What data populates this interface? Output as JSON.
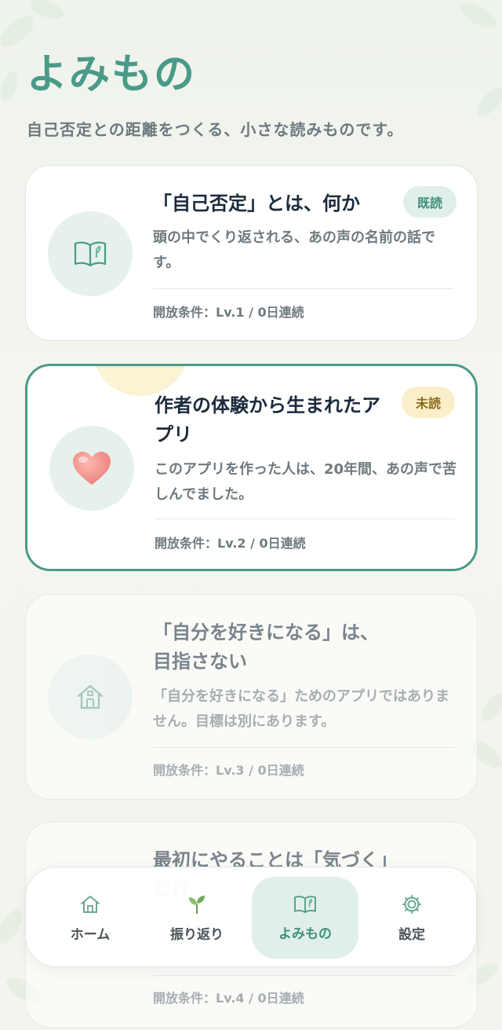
{
  "header": {
    "title": "よみもの",
    "subtitle": "自己否定との距離をつくる、小さな読みものです。"
  },
  "articles": [
    {
      "title": "「自己否定」とは、何か",
      "description": "頭の中でくり返される、あの声の名前の話です。",
      "condition": "開放条件：Lv.1 / 0日連続",
      "badge": "既読",
      "icon": "book-icon",
      "state": "read"
    },
    {
      "title": "作者の体験から生まれたアプリ",
      "description": "このアプリを作った人は、20年間、あの声で苦しんでました。",
      "condition": "開放条件：Lv.2 / 0日連続",
      "badge": "未読",
      "icon": "heart-icon",
      "state": "unread"
    },
    {
      "title": "「自分を好きになる」は、目指さない",
      "description": "「自分を好きになる」ためのアプリではありません。目標は別にあります。",
      "condition": "開放条件：Lv.3 / 0日連続",
      "badge": "",
      "icon": "house-icon",
      "state": "locked"
    },
    {
      "title": "最初にやることは「気づく」だけ",
      "description": "",
      "condition": "開放条件：Lv.4 / 0日連続",
      "badge": "",
      "icon": "",
      "state": "locked"
    }
  ],
  "nav": {
    "items": [
      {
        "label": "ホーム",
        "icon": "home-icon"
      },
      {
        "label": "振り返り",
        "icon": "sprout-icon"
      },
      {
        "label": "よみもの",
        "icon": "book-icon",
        "active": true
      },
      {
        "label": "設定",
        "icon": "gear-icon"
      }
    ]
  },
  "colors": {
    "accent": "#4a9a88",
    "read_badge_bg": "#e0efe9",
    "unread_badge_bg": "#fbefc9",
    "title_text": "#1c2b3c"
  }
}
